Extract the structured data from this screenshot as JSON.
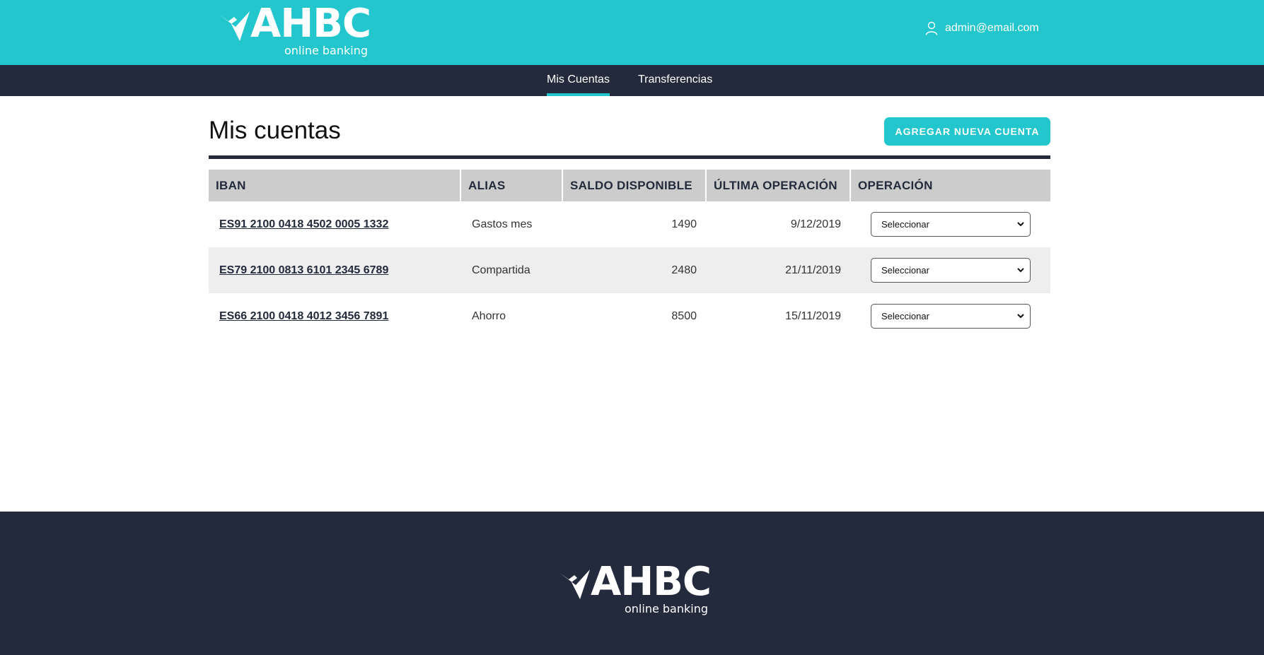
{
  "header": {
    "logo_text": "AHBC",
    "logo_subtitle": "online banking",
    "user_email": "admin@email.com",
    "colors": {
      "brand": "#24c6cd",
      "dark": "#232a3b"
    }
  },
  "nav": {
    "items": [
      {
        "label": "Mis Cuentas",
        "active": true
      },
      {
        "label": "Transferencias",
        "active": false
      }
    ]
  },
  "main": {
    "title": "Mis cuentas",
    "add_button_label": "AGREGAR NUEVA CUENTA",
    "table": {
      "headers": [
        "IBAN",
        "ALIAS",
        "SALDO DISPONIBLE",
        "ÚLTIMA OPERACIÓN",
        "OPERACIÓN"
      ],
      "rows": [
        {
          "iban": "ES91 2100 0418 4502 0005 1332",
          "alias": "Gastos mes",
          "saldo": "1490",
          "ultima": "9/12/2019",
          "operacion": "Seleccionar"
        },
        {
          "iban": "ES79 2100 0813 6101 2345 6789",
          "alias": "Compartida",
          "saldo": "2480",
          "ultima": "21/11/2019",
          "operacion": "Seleccionar"
        },
        {
          "iban": "ES66 2100 0418 4012 3456 7891",
          "alias": "Ahorro",
          "saldo": "8500",
          "ultima": "15/11/2019",
          "operacion": "Seleccionar"
        }
      ]
    }
  },
  "footer": {
    "logo_text": "AHBC",
    "logo_subtitle": "online banking"
  },
  "icons": {
    "logo": "bird-logo-icon",
    "user": "user-icon",
    "select": "chevron-down-icon"
  }
}
